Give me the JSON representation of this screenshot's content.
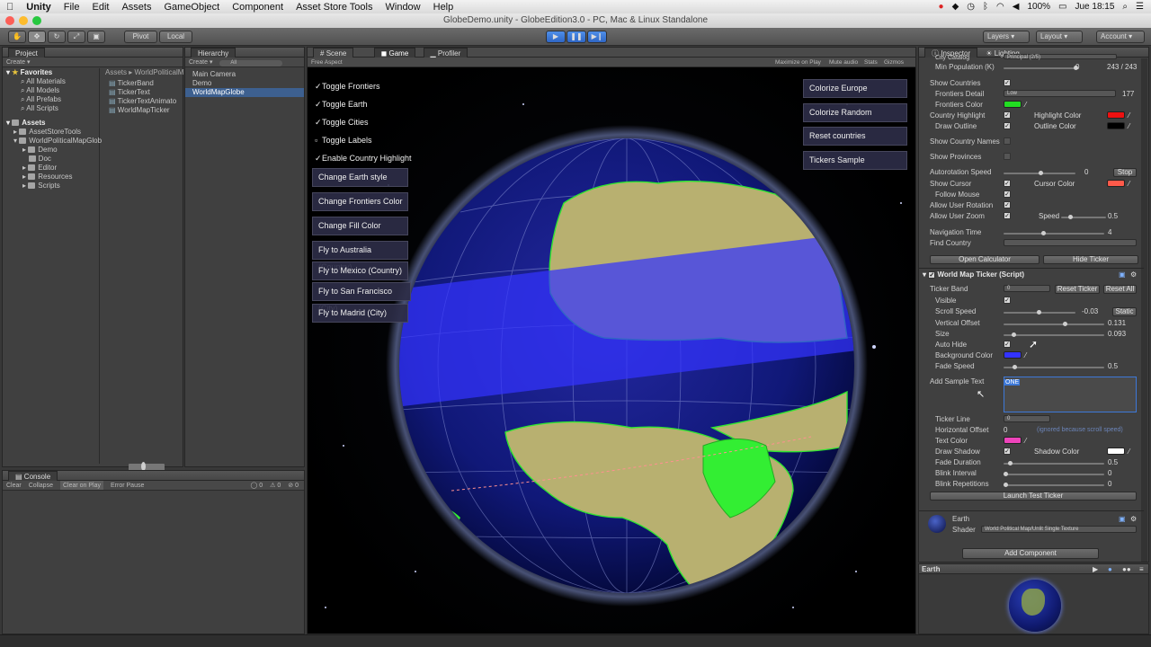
{
  "menubar": {
    "app": "Unity",
    "items": [
      "File",
      "Edit",
      "Assets",
      "GameObject",
      "Component",
      "Asset Store Tools",
      "Window",
      "Help"
    ],
    "battery": "100%",
    "date": "Jue 18:15"
  },
  "window": {
    "title": "GlobeDemo.unity - GlobeEdition3.0 - PC, Mac & Linux Standalone"
  },
  "toolbar": {
    "pivot": "Pivot",
    "local": "Local",
    "layers": "Layers",
    "layout": "Layout",
    "account": "Account"
  },
  "project": {
    "tab": "Project",
    "create": "Create",
    "favorites": "Favorites",
    "fav_items": [
      "All Materials",
      "All Models",
      "All Prefabs",
      "All Scripts"
    ],
    "assets": "Assets",
    "asset_items": [
      "AssetStoreTools",
      "WorldPoliticalMapGlob"
    ],
    "sub_items": [
      "Demo",
      "Doc",
      "Editor",
      "Resources",
      "Scripts"
    ],
    "breadcrumb": "Assets ▸ WorldPoliticalM",
    "files": [
      "TickerBand",
      "TickerText",
      "TickerTextAnimato",
      "WorldMapTicker"
    ]
  },
  "hierarchy": {
    "tab": "Hierarchy",
    "create": "Create",
    "search": "All",
    "items": [
      "Main Camera",
      "Demo",
      "WorldMapGlobe"
    ]
  },
  "console": {
    "tab": "Console",
    "buttons": [
      "Clear",
      "Collapse",
      "Clear on Play",
      "Error Pause"
    ],
    "counts": [
      "0",
      "0",
      "0"
    ]
  },
  "scene_tabs": {
    "scene": "Scene",
    "game": "Game",
    "profiler": "Profiler"
  },
  "game": {
    "aspect": "Free Aspect",
    "options": [
      "Maximize on Play",
      "Mute audio",
      "Stats",
      "Gizmos"
    ],
    "toggles": [
      "Toggle Frontiers",
      "Toggle Earth",
      "Toggle Cities",
      "Toggle Labels",
      "Enable Country Highlight"
    ],
    "left_buttons": [
      "Change Earth style",
      "Change Frontiers Color",
      "Change Fill Color",
      "Fly to Australia (Country)",
      "Fly to Mexico (Country)",
      "Fly to San Francisco (City)",
      "Fly to Madrid (City)"
    ],
    "right_buttons": [
      "Colorize Europe",
      "Colorize Random",
      "Reset countries",
      "Tickers Sample"
    ]
  },
  "inspector": {
    "tab": "Inspector",
    "tab2": "Lighting",
    "city_catalog": "City Catalog",
    "city_catalog_val": "Principal (2/5)",
    "min_population": "Min Population (K)",
    "min_population_val": "0",
    "min_population_range": "243 / 243",
    "show_countries": "Show Countries",
    "frontiers_detail": "Frontiers Detail",
    "frontiers_detail_val": "Low",
    "frontiers_count": "177",
    "frontiers_color": "Frontiers Color",
    "country_highlight": "Country Highlight",
    "highlight_color": "Highlight Color",
    "draw_outline": "Draw Outline",
    "outline_color": "Outline Color",
    "show_country_names": "Show Country Names",
    "show_provinces": "Show Provinces",
    "autorotation_speed": "Autorotation Speed",
    "autorotation_val": "0",
    "stop": "Stop",
    "show_cursor": "Show Cursor",
    "cursor_color": "Cursor Color",
    "follow_mouse": "Follow Mouse",
    "allow_user_rotation": "Allow User Rotation",
    "allow_user_zoom": "Allow User Zoom",
    "speed": "Speed",
    "speed_val": "0.5",
    "navigation_time": "Navigation Time",
    "navigation_val": "4",
    "find_country": "Find Country",
    "open_calculator": "Open Calculator",
    "hide_ticker": "Hide Ticker",
    "component": "World Map Ticker (Script)",
    "ticker_band": "Ticker Band",
    "ticker_band_val": "0",
    "reset_ticker": "Reset Ticker",
    "reset_all": "Reset All",
    "visible": "Visible",
    "scroll_speed": "Scroll Speed",
    "scroll_speed_val": "-0.03",
    "static": "Static",
    "vertical_offset": "Vertical Offset",
    "vertical_offset_val": "0.131",
    "size": "Size",
    "size_val": "0.093",
    "auto_hide": "Auto Hide",
    "background_color": "Background Color",
    "fade_speed": "Fade Speed",
    "fade_speed_val": "0.5",
    "add_sample_text": "Add Sample Text",
    "sample_text": "ONE",
    "ticker_line": "Ticker Line",
    "ticker_line_val": "0",
    "horizontal_offset": "Horizontal Offset",
    "horizontal_offset_val": "0",
    "ignored_note": "(ignored because scroll speed)",
    "text_color": "Text Color",
    "draw_shadow": "Draw Shadow",
    "shadow_color": "Shadow Color",
    "fade_duration": "Fade Duration",
    "fade_duration_val": "0.5",
    "blink_interval": "Blink Interval",
    "blink_interval_val": "0",
    "blink_repetitions": "Blink Repetitions",
    "blink_repetitions_val": "0",
    "launch_test_ticker": "Launch Test Ticker",
    "material_name": "Earth",
    "shader": "Shader",
    "shader_val": "World Political Map/Unlit Single Texture",
    "add_component": "Add Component",
    "preview_name": "Earth"
  },
  "colors": {
    "frontiers": "#22dd22",
    "highlight": "#ee1111",
    "outline": "#000000",
    "cursor": "#ff5a4a",
    "background": "#3333ff",
    "text": "#ee44bb",
    "shadow": "#ffffff",
    "accent": "#3d78d8"
  }
}
